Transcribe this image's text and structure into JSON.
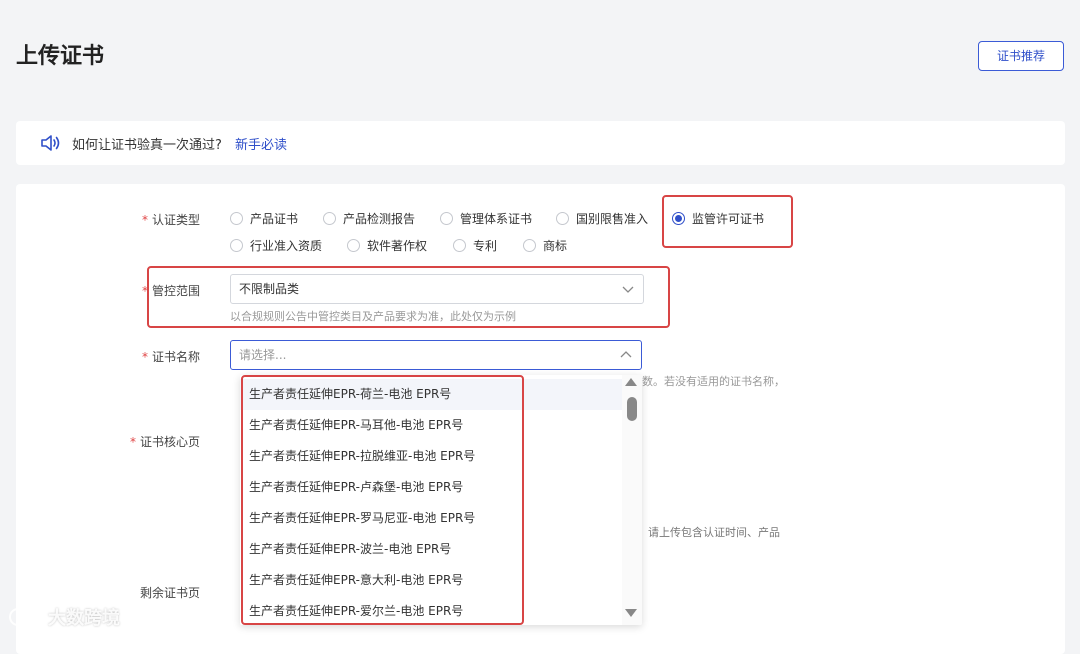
{
  "header": {
    "title": "上传证书",
    "recommend_button": "证书推荐"
  },
  "notice": {
    "text": "如何让证书验真一次通过?",
    "link": "新手必读",
    "icon": "speaker-icon"
  },
  "form": {
    "cert_type": {
      "label": "认证类型",
      "options": [
        "产品证书",
        "产品检测报告",
        "管理体系证书",
        "国别限售准入",
        "监管许可证书",
        "行业准入资质",
        "软件著作权",
        "专利",
        "商标"
      ],
      "selected": "监管许可证书"
    },
    "control_scope": {
      "label": "管控范围",
      "value": "不限制品类",
      "hint": "以合规规则公告中管控类目及产品要求为准，此处仅为示例"
    },
    "cert_name": {
      "label": "证书名称",
      "placeholder": "请选择...",
      "hint_partial": "数。若没有适用的证书名称，",
      "options": [
        "生产者责任延伸EPR-荷兰-电池 EPR号",
        "生产者责任延伸EPR-马耳他-电池 EPR号",
        "生产者责任延伸EPR-拉脱维亚-电池 EPR号",
        "生产者责任延伸EPR-卢森堡-电池 EPR号",
        "生产者责任延伸EPR-罗马尼亚-电池 EPR号",
        "生产者责任延伸EPR-波兰-电池 EPR号",
        "生产者责任延伸EPR-意大利-电池 EPR号",
        "生产者责任延伸EPR-爱尔兰-电池 EPR号"
      ]
    },
    "core_page": {
      "label": "证书核心页",
      "hint_partial": "请上传包含认证时间、产品"
    },
    "remaining_pages": {
      "label": "剩余证书页"
    }
  },
  "watermark": {
    "text": "大数跨境"
  },
  "colors": {
    "accent": "#2f4fc9",
    "required": "#e04545",
    "highlight_box": "#d84545"
  }
}
